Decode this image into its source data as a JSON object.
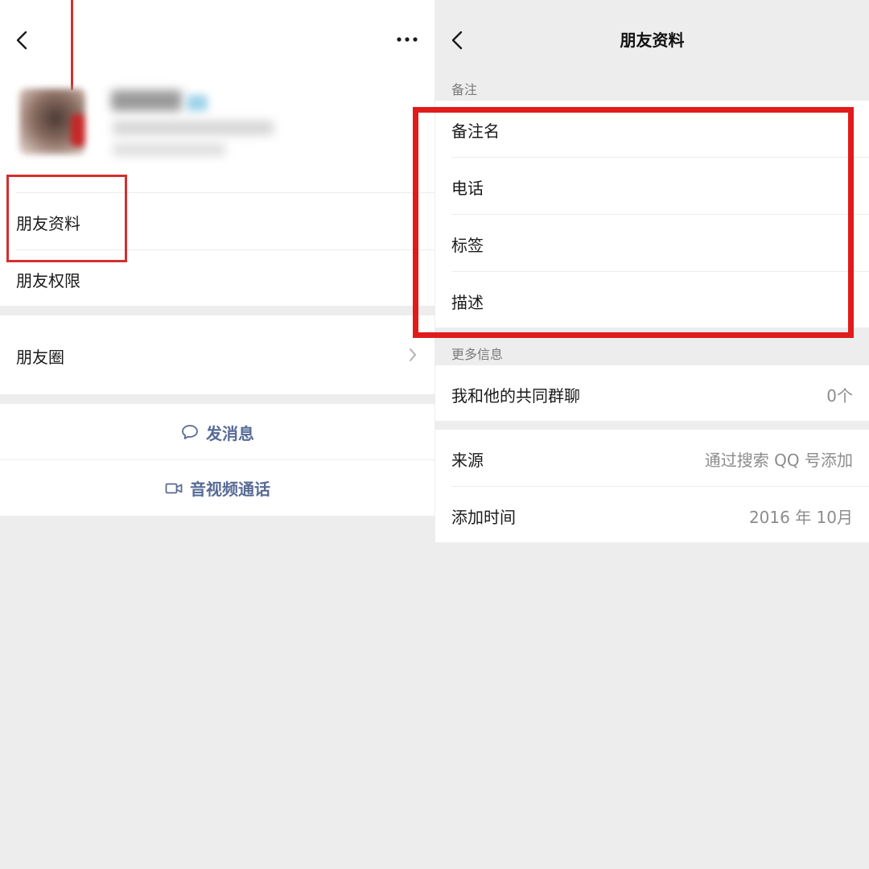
{
  "left": {
    "rows": [
      {
        "label": "朋友资料"
      },
      {
        "label": "朋友权限"
      },
      {
        "label": "朋友圈"
      }
    ],
    "actions": [
      {
        "label": "发消息",
        "icon": "chat-bubble-icon"
      },
      {
        "label": "音视频通话",
        "icon": "video-camera-icon"
      }
    ]
  },
  "right": {
    "title": "朋友资料",
    "sections": [
      {
        "label": "备注"
      },
      {
        "label": "更多信息"
      }
    ],
    "remark_rows": [
      {
        "label": "备注名"
      },
      {
        "label": "电话"
      },
      {
        "label": "标签"
      },
      {
        "label": "描述"
      }
    ],
    "info_rows": [
      {
        "label": "我和他的共同群聊",
        "value": "0个"
      },
      {
        "label": "来源",
        "value": "通过搜索 QQ 号添加"
      },
      {
        "label": "添加时间",
        "value": "2016 年 10月"
      }
    ]
  },
  "colors": {
    "highlight": "#d32f2f",
    "link": "#576b95",
    "background": "#ededed"
  }
}
